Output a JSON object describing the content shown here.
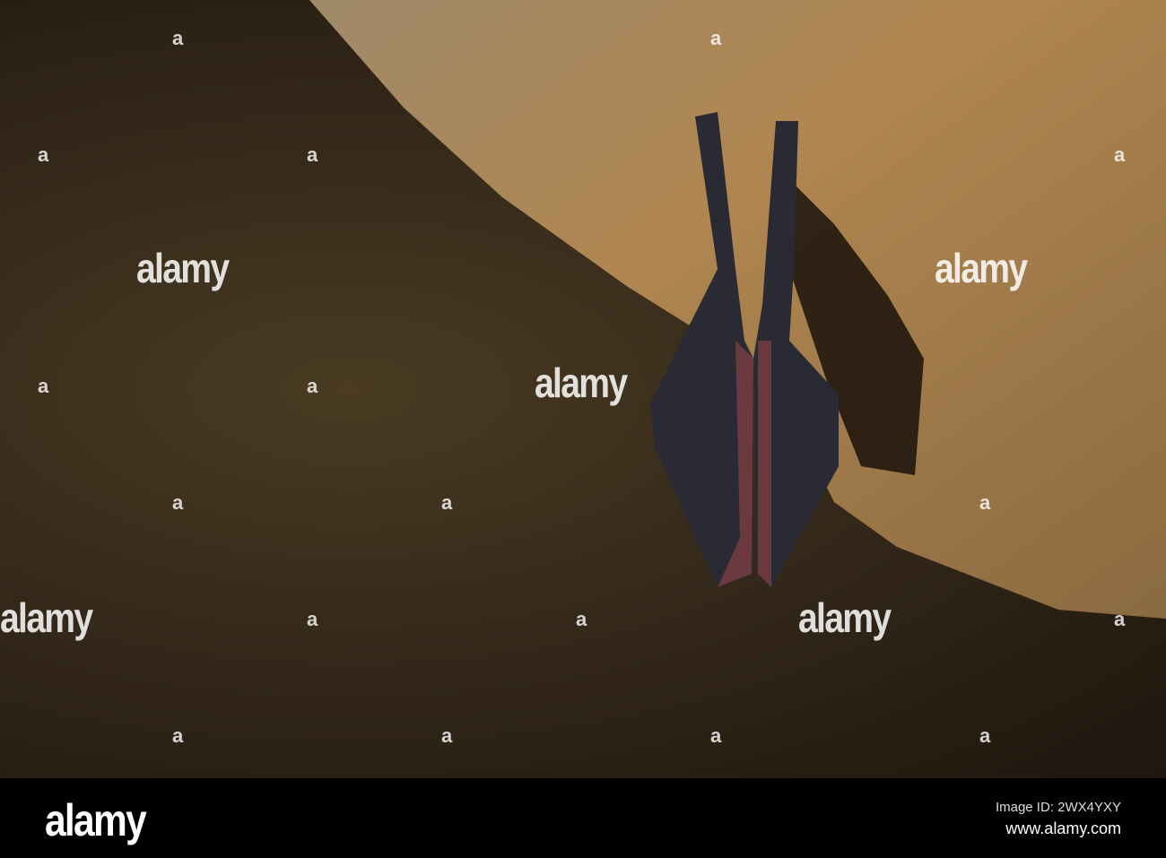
{
  "watermark": {
    "logo_text": "alamy"
  },
  "footer": {
    "logo": "alamy",
    "image_id": "Image ID: 2WX4YXY",
    "url": "www.alamy.com"
  }
}
